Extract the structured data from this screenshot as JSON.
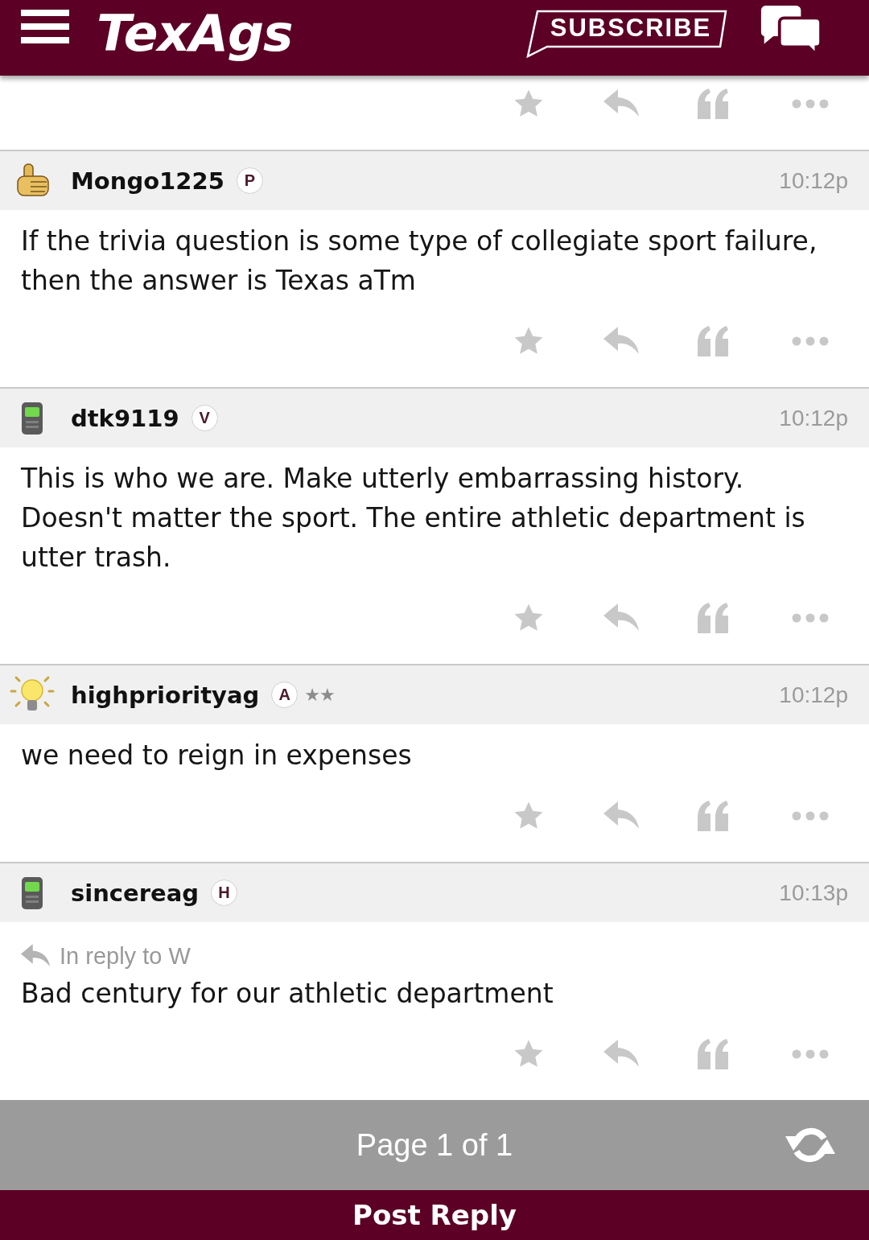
{
  "header": {
    "logo": "TexAgs",
    "subscribe": "SUBSCRIBE"
  },
  "posts": [
    {
      "kind": "cut-off"
    },
    {
      "kind": "full",
      "avatar": {
        "kind": "thumbs-up"
      },
      "username": "Mongo1225",
      "badge": "P",
      "time": "10:12p",
      "text": "If the trivia question is some type of collegiate sport failure, then the answer is Texas aTm"
    },
    {
      "kind": "full",
      "avatar": {
        "kind": "phone"
      },
      "username": "dtk9119",
      "badge": "V",
      "time": "10:12p",
      "text": "This is who we are. Make utterly embarrassing history. Doesn't matter the sport. The entire athletic department is utter trash."
    },
    {
      "kind": "full",
      "avatar": {
        "kind": "lightbulb"
      },
      "username": "highpriorityag",
      "badge": "A",
      "rank_stars": "★★",
      "time": "10:12p",
      "text": "we need to reign in expenses"
    },
    {
      "kind": "full",
      "avatar": {
        "kind": "phone"
      },
      "username": "sincereag",
      "badge": "H",
      "time": "10:13p",
      "reply_to": "In reply to W",
      "text": "Bad century for our athletic department"
    }
  ],
  "pagination": {
    "label": "Page 1 of 1"
  },
  "post_reply": {
    "label": "Post Reply"
  }
}
